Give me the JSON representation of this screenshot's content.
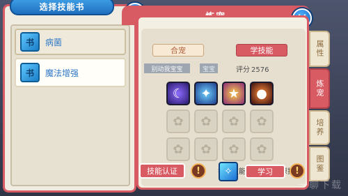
{
  "left_panel": {
    "title": "选择技能书",
    "books": [
      {
        "icon_text": "书",
        "name": "病菌"
      },
      {
        "icon_text": "书",
        "name": "魔法增强"
      }
    ]
  },
  "main_panel": {
    "title": "炼宠",
    "tabs": {
      "merge": "合宠",
      "learn": "学技能"
    },
    "pet_name": "别动我宝宝",
    "pet_tag": "宝宝",
    "score_label": "评分",
    "score_value": "2576",
    "hint": "学习技能有可能覆盖原技能",
    "cert_button": "技能认证",
    "learn_button": "学习",
    "info_glyph": "!"
  },
  "side_tabs": [
    "属性",
    "炼宠",
    "培养",
    "图鉴"
  ],
  "watermark": "一聊下载"
}
